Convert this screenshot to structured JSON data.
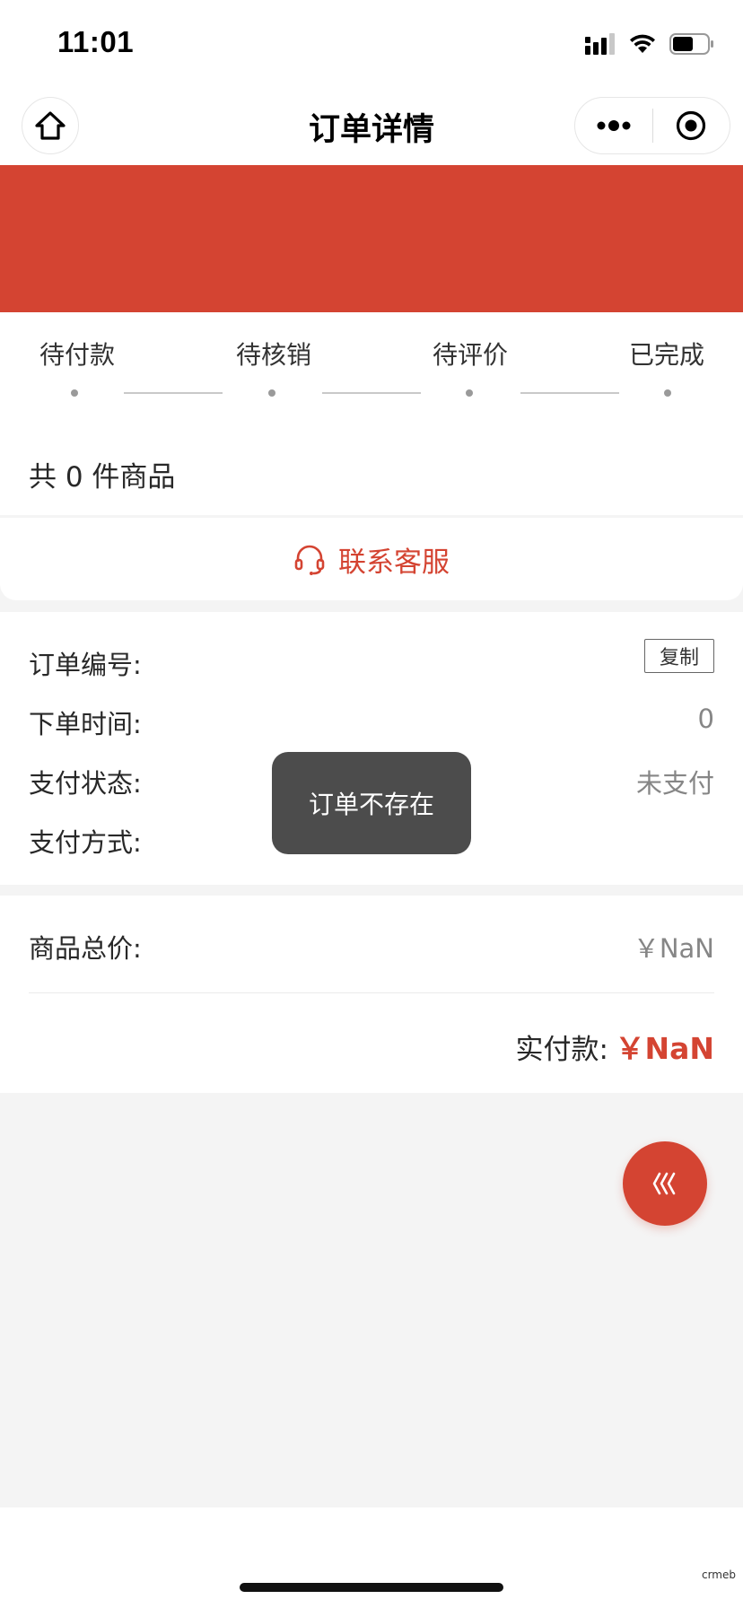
{
  "status_bar": {
    "time": "11:01"
  },
  "nav": {
    "title": "订单详情"
  },
  "progress": {
    "steps": [
      "待付款",
      "待核销",
      "待评价",
      "已完成"
    ]
  },
  "goods": {
    "count_text": "共 0 件商品"
  },
  "contact": {
    "label": "联系客服"
  },
  "order_info": {
    "order_no_label": "订单编号:",
    "copy_label": "复制",
    "order_time_label": "下单时间:",
    "order_time_value": "0",
    "pay_status_label": "支付状态:",
    "pay_status_value": "未支付",
    "pay_method_label": "支付方式:"
  },
  "price": {
    "total_label": "商品总价:",
    "total_value": "￥NaN",
    "paid_label": "实付款:",
    "paid_value": "￥NaN"
  },
  "toast": {
    "message": "订单不存在"
  },
  "watermark": {
    "text": "crmeb"
  },
  "colors": {
    "accent": "#d44432",
    "toast_bg": "#4c4c4c",
    "page_bg": "#f4f4f4"
  }
}
